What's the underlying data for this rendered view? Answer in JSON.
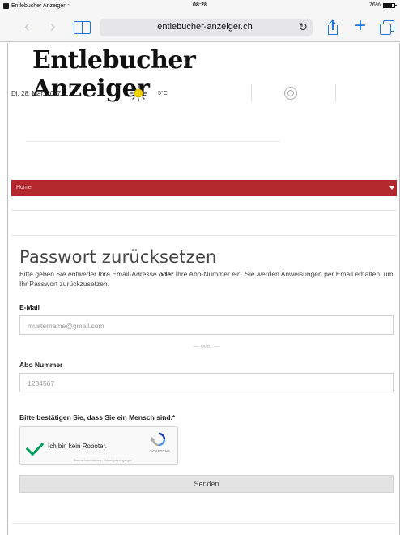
{
  "status_bar": {
    "app_name": "Entlebucher Anzeiger",
    "time": "08:28",
    "battery": "76%"
  },
  "browser": {
    "url": "entlebucher-anzeiger.ch",
    "back_icon": "chevron-left-icon",
    "forward_icon": "chevron-right-icon",
    "bookmarks_icon": "book-icon",
    "reload_icon": "reload-icon",
    "share_icon": "share-icon",
    "new_tab_icon": "plus-icon",
    "tabs_icon": "tabs-icon",
    "accent_color": "#1a76e3"
  },
  "header": {
    "masthead": "Entlebucher Anzeiger",
    "date": "Di, 28. Mär. 2017",
    "weather_icon": "sun-icon",
    "temperature": "5°C",
    "search_icon": "search-icon"
  },
  "nav": {
    "home": "Home",
    "color": "#b3282d"
  },
  "form": {
    "title": "Passwort zurücksetzen",
    "intro_before": "Bitte geben Sie entweder Ihre Email-Adresse ",
    "intro_bold": "oder",
    "intro_after": " Ihre Abo-Nummer ein. Sie werden Anweisungen per Email erhalten, um Ihr Passwort zurückzusetzen.",
    "email_label": "E-Mail",
    "email_placeholder": "mustername@gmail.com",
    "separator": "— oder —",
    "abo_label": "Abo Nummer",
    "abo_placeholder": "1234567",
    "captcha_prompt": "Bitte bestätigen Sie, dass Sie ein Mensch sind.*",
    "captcha_checkbox_label": "Ich bin kein Roboter.",
    "captcha_brand": "reCAPTCHA",
    "captcha_terms": "Datenschutzerklärung - Nutzungsbedingungen",
    "submit_label": "Senden"
  }
}
